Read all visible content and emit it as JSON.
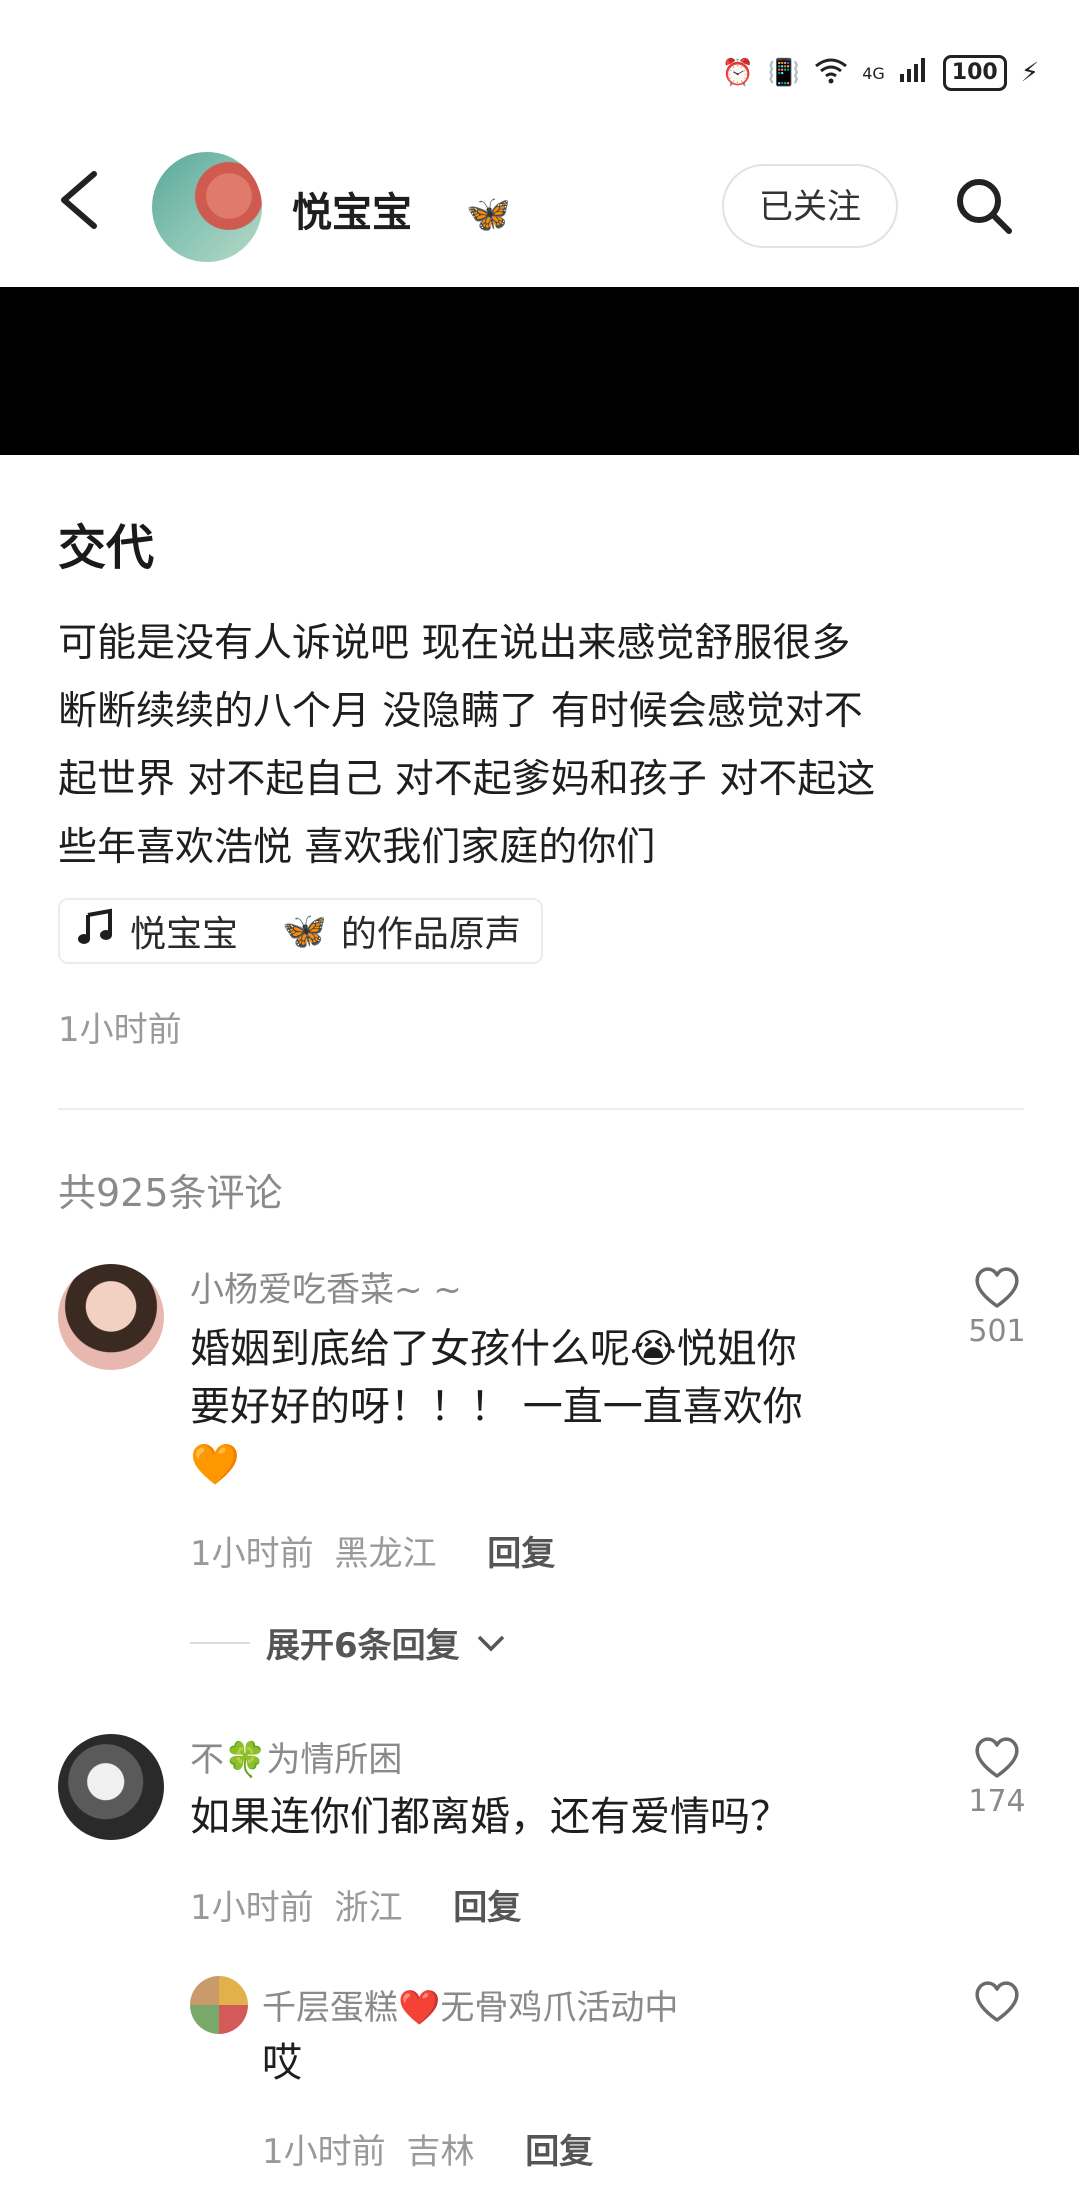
{
  "status_bar": {
    "network": "4G",
    "battery": "100"
  },
  "header": {
    "username": "悦宝宝",
    "follow_label": "已关注"
  },
  "post": {
    "title": "交代",
    "body_lines": [
      "可能是没有人诉说吧 现在说出来感觉舒服很多",
      "断断续续的八个月 没隐瞒了 有时候会感觉对不",
      "起世界 对不起自己 对不起爹妈和孩子 对不起这",
      "些年喜欢浩悦 喜欢我们家庭的你们"
    ],
    "music_author": "悦宝宝",
    "music_suffix": "的作品原声",
    "time": "1小时前"
  },
  "comments_count_label": "共925条评论",
  "comments": [
    {
      "name": "小杨爱吃香菜~ ~",
      "lines": [
        "婚姻到底给了女孩什么呢😭悦姐你",
        "要好好的呀！！！ 一直一直喜欢你",
        "🧡"
      ],
      "time": "1小时前",
      "location": "黑龙江",
      "reply_label": "回复",
      "likes": "501",
      "expand_label": "展开6条回复"
    },
    {
      "name": "不🍀为情所困",
      "lines": [
        "如果连你们都离婚，还有爱情吗？"
      ],
      "time": "1小时前",
      "location": "浙江",
      "reply_label": "回复",
      "likes": "174"
    }
  ],
  "sub_reply": {
    "name": "千层蛋糕❤️无骨鸡爪活动中",
    "text": "哎",
    "time": "1小时前",
    "location": "吉林",
    "reply_label": "回复"
  },
  "colors": {
    "follow_border": "#e2e2e2",
    "muted_text": "#8a8a8a",
    "black_bar": "#000000"
  },
  "icons": [
    "back-arrow-icon",
    "butterfly-icon",
    "search-icon",
    "music-note-icon",
    "heart-outline-icon",
    "chevron-down-icon"
  ]
}
